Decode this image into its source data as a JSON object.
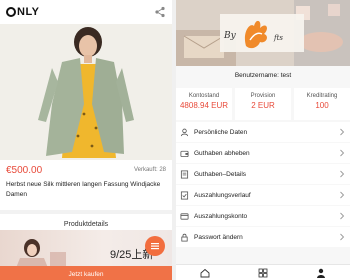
{
  "left": {
    "brand": "NLY",
    "product": {
      "price": "€500.00",
      "sold": "Verkauft: 28",
      "title": "Herbst neue Silk mittleren langen Fassung Windjacke Damen"
    },
    "section_label": "Produktdetails",
    "promo_text": "9/25上新",
    "buy_button": "Jetzt kaufen",
    "icons": {
      "share": "share-icon",
      "fab": "menu-icon"
    }
  },
  "right": {
    "logo_text_left": "By",
    "logo_text_right": "fts",
    "username": "Benutzername: test",
    "stats": [
      {
        "label": "Kontostand",
        "value": "4808.94 EUR"
      },
      {
        "label": "Provision",
        "value": "2 EUR"
      },
      {
        "label": "Kreditrating",
        "value": "100"
      }
    ],
    "menu": [
      {
        "label": "Persönliche Daten",
        "icon": "user-icon"
      },
      {
        "label": "Guthaben abheben",
        "icon": "wallet-icon"
      },
      {
        "label": "Guthaben–Details",
        "icon": "list-icon"
      },
      {
        "label": "Auszahlungsverlauf",
        "icon": "checklist-icon"
      },
      {
        "label": "Auszahlungskonto",
        "icon": "card-icon"
      },
      {
        "label": "Passwort ändern",
        "icon": "lock-icon"
      }
    ],
    "tabbar": [
      "home-icon",
      "grid-icon",
      "profile-icon"
    ]
  },
  "colors": {
    "accent": "#f07247",
    "price": "#e84a3a"
  }
}
